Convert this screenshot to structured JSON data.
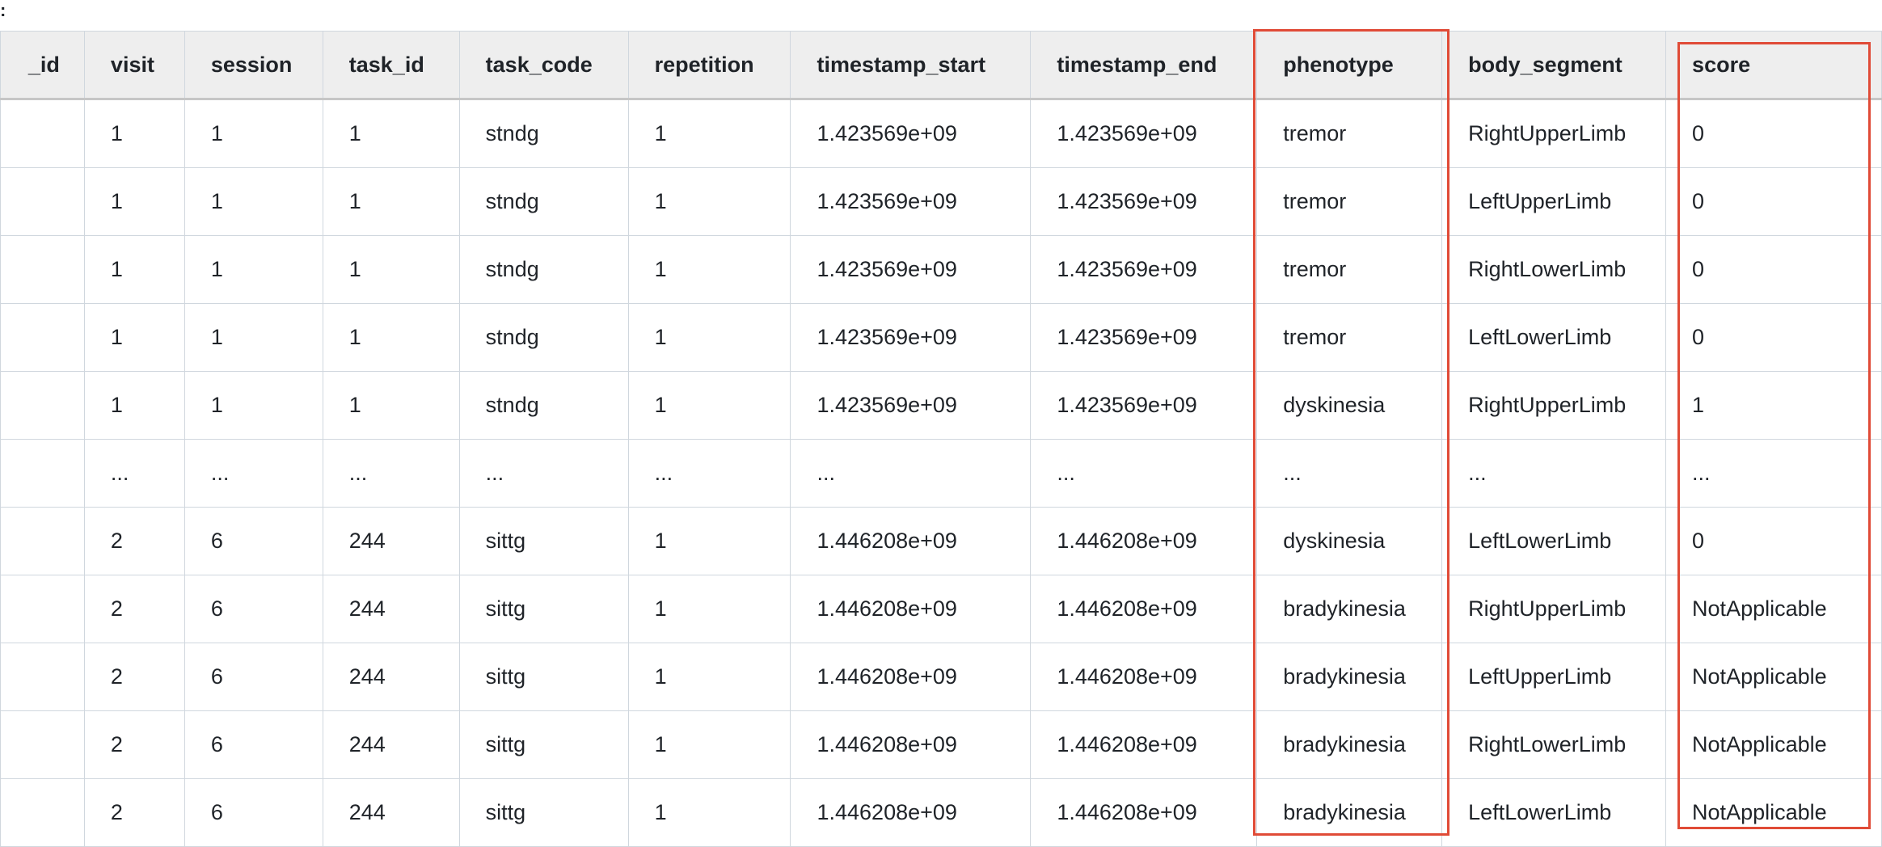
{
  "corner_text": ":",
  "table": {
    "columns": [
      "_id",
      "visit",
      "session",
      "task_id",
      "task_code",
      "repetition",
      "timestamp_start",
      "timestamp_end",
      "phenotype",
      "body_segment",
      "score"
    ],
    "rows": [
      [
        "",
        "1",
        "1",
        "1",
        "stndg",
        "1",
        "1.423569e+09",
        "1.423569e+09",
        "tremor",
        "RightUpperLimb",
        "0"
      ],
      [
        "",
        "1",
        "1",
        "1",
        "stndg",
        "1",
        "1.423569e+09",
        "1.423569e+09",
        "tremor",
        "LeftUpperLimb",
        "0"
      ],
      [
        "",
        "1",
        "1",
        "1",
        "stndg",
        "1",
        "1.423569e+09",
        "1.423569e+09",
        "tremor",
        "RightLowerLimb",
        "0"
      ],
      [
        "",
        "1",
        "1",
        "1",
        "stndg",
        "1",
        "1.423569e+09",
        "1.423569e+09",
        "tremor",
        "LeftLowerLimb",
        "0"
      ],
      [
        "",
        "1",
        "1",
        "1",
        "stndg",
        "1",
        "1.423569e+09",
        "1.423569e+09",
        "dyskinesia",
        "RightUpperLimb",
        "1"
      ],
      [
        "",
        "...",
        "...",
        "...",
        "...",
        "...",
        "...",
        "...",
        "...",
        "...",
        "..."
      ],
      [
        "",
        "2",
        "6",
        "244",
        "sittg",
        "1",
        "1.446208e+09",
        "1.446208e+09",
        "dyskinesia",
        "LeftLowerLimb",
        "0"
      ],
      [
        "",
        "2",
        "6",
        "244",
        "sittg",
        "1",
        "1.446208e+09",
        "1.446208e+09",
        "bradykinesia",
        "RightUpperLimb",
        "NotApplicable"
      ],
      [
        "",
        "2",
        "6",
        "244",
        "sittg",
        "1",
        "1.446208e+09",
        "1.446208e+09",
        "bradykinesia",
        "LeftUpperLimb",
        "NotApplicable"
      ],
      [
        "",
        "2",
        "6",
        "244",
        "sittg",
        "1",
        "1.446208e+09",
        "1.446208e+09",
        "bradykinesia",
        "RightLowerLimb",
        "NotApplicable"
      ],
      [
        "",
        "2",
        "6",
        "244",
        "sittg",
        "1",
        "1.446208e+09",
        "1.446208e+09",
        "bradykinesia",
        "LeftLowerLimb",
        "NotApplicable"
      ]
    ]
  },
  "highlighted_columns": [
    "phenotype",
    "score"
  ],
  "colors": {
    "highlight_border": "#e04b37",
    "header_bg": "#eeeeee",
    "grid_line": "#d0d7de"
  }
}
